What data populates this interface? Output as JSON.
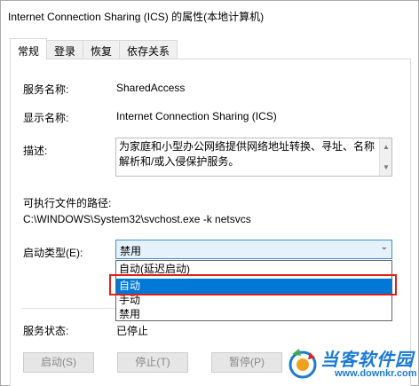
{
  "window": {
    "title": "Internet Connection Sharing (ICS) 的属性(本地计算机)"
  },
  "tabs": [
    {
      "label": "常规",
      "active": true
    },
    {
      "label": "登录",
      "active": false
    },
    {
      "label": "恢复",
      "active": false
    },
    {
      "label": "依存关系",
      "active": false
    }
  ],
  "general": {
    "service_name_label": "服务名称:",
    "service_name_value": "SharedAccess",
    "display_name_label": "显示名称:",
    "display_name_value": "Internet Connection Sharing (ICS)",
    "description_label": "描述:",
    "description_value": "为家庭和小型办公网络提供网络地址转换、寻址、名称解析和/或入侵保护服务。",
    "exe_path_label": "可执行文件的路径:",
    "exe_path_value": "C:\\WINDOWS\\System32\\svchost.exe -k netsvcs",
    "startup_type_label": "启动类型(E):",
    "startup_type_value": "禁用",
    "startup_options": [
      "自动(延迟启动)",
      "自动",
      "手动",
      "禁用"
    ],
    "startup_selected_option": "自动",
    "service_status_label": "服务状态:",
    "service_status_value": "已停止"
  },
  "buttons": {
    "start": "启动(S)",
    "stop": "停止(T)",
    "pause": "暂停(P)"
  },
  "watermark": {
    "title": "当客软件园",
    "url": "www.downkr.com"
  },
  "colors": {
    "selection": "#0078d7",
    "select_border": "#3c8fd9",
    "highlight_border": "#e0211a",
    "watermark": "#1a7ad4"
  }
}
